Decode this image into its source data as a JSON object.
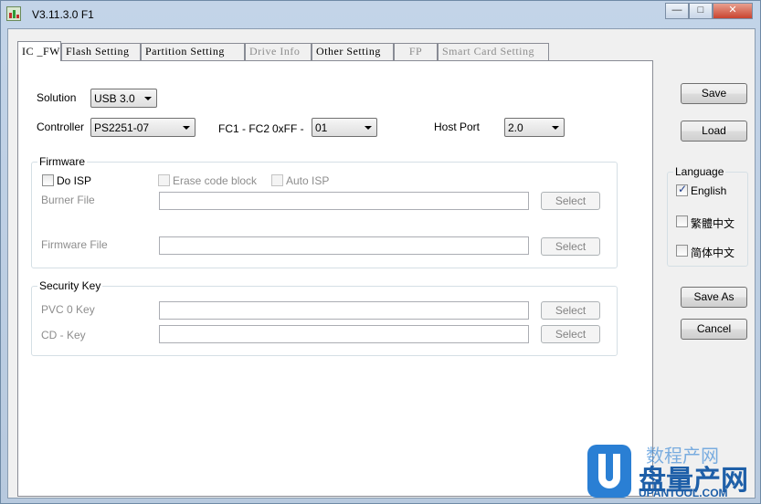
{
  "window": {
    "title": "V3.11.3.0 F1",
    "min_label": "—",
    "max_label": "□",
    "close_label": "✕"
  },
  "tabs": [
    {
      "label": "IC _FW",
      "state": "active"
    },
    {
      "label": "Flash Setting",
      "state": "normal"
    },
    {
      "label": "Partition Setting",
      "state": "normal"
    },
    {
      "label": "Drive Info",
      "state": "disabled"
    },
    {
      "label": "Other Setting",
      "state": "normal"
    },
    {
      "label": "FP",
      "state": "disabled"
    },
    {
      "label": "Smart Card Setting",
      "state": "disabled"
    }
  ],
  "ic_fw": {
    "solution_label": "Solution",
    "solution_value": "USB 3.0",
    "controller_label": "Controller",
    "controller_value": "PS2251-07",
    "fc_label": "FC1 - FC2",
    "oxff_label": "0xFF -",
    "oxff_value": "01",
    "host_port_label": "Host Port",
    "host_port_value": "2.0"
  },
  "firmware": {
    "caption": "Firmware",
    "do_isp_label": "Do ISP",
    "do_isp_checked": false,
    "erase_code_label": "Erase code block",
    "auto_isp_label": "Auto ISP",
    "burner_label": "Burner File",
    "burner_value": "",
    "firmware_label": "Firmware File",
    "firmware_value": "",
    "select_label": "Select"
  },
  "security": {
    "caption": "Security Key",
    "pvc_label": "PVC 0 Key",
    "pvc_value": "",
    "cd_label": "CD - Key",
    "cd_value": "",
    "select_label": "Select"
  },
  "side": {
    "save_label": "Save",
    "load_label": "Load",
    "language_caption": "Language",
    "languages": [
      {
        "label": "English",
        "checked": true
      },
      {
        "label": "繁體中文",
        "checked": false
      },
      {
        "label": "简体中文",
        "checked": false
      }
    ],
    "save_as_label": "Save As",
    "cancel_label": "Cancel"
  },
  "watermark": {
    "top_text": "数程产网",
    "main_text": "盘量产网",
    "url_text": "UPANTOOL.COM"
  },
  "colors": {
    "accent": "#1e5fa8",
    "watermark_blue": "#2a7fd4",
    "disabled_text": "#8d8d8d"
  }
}
